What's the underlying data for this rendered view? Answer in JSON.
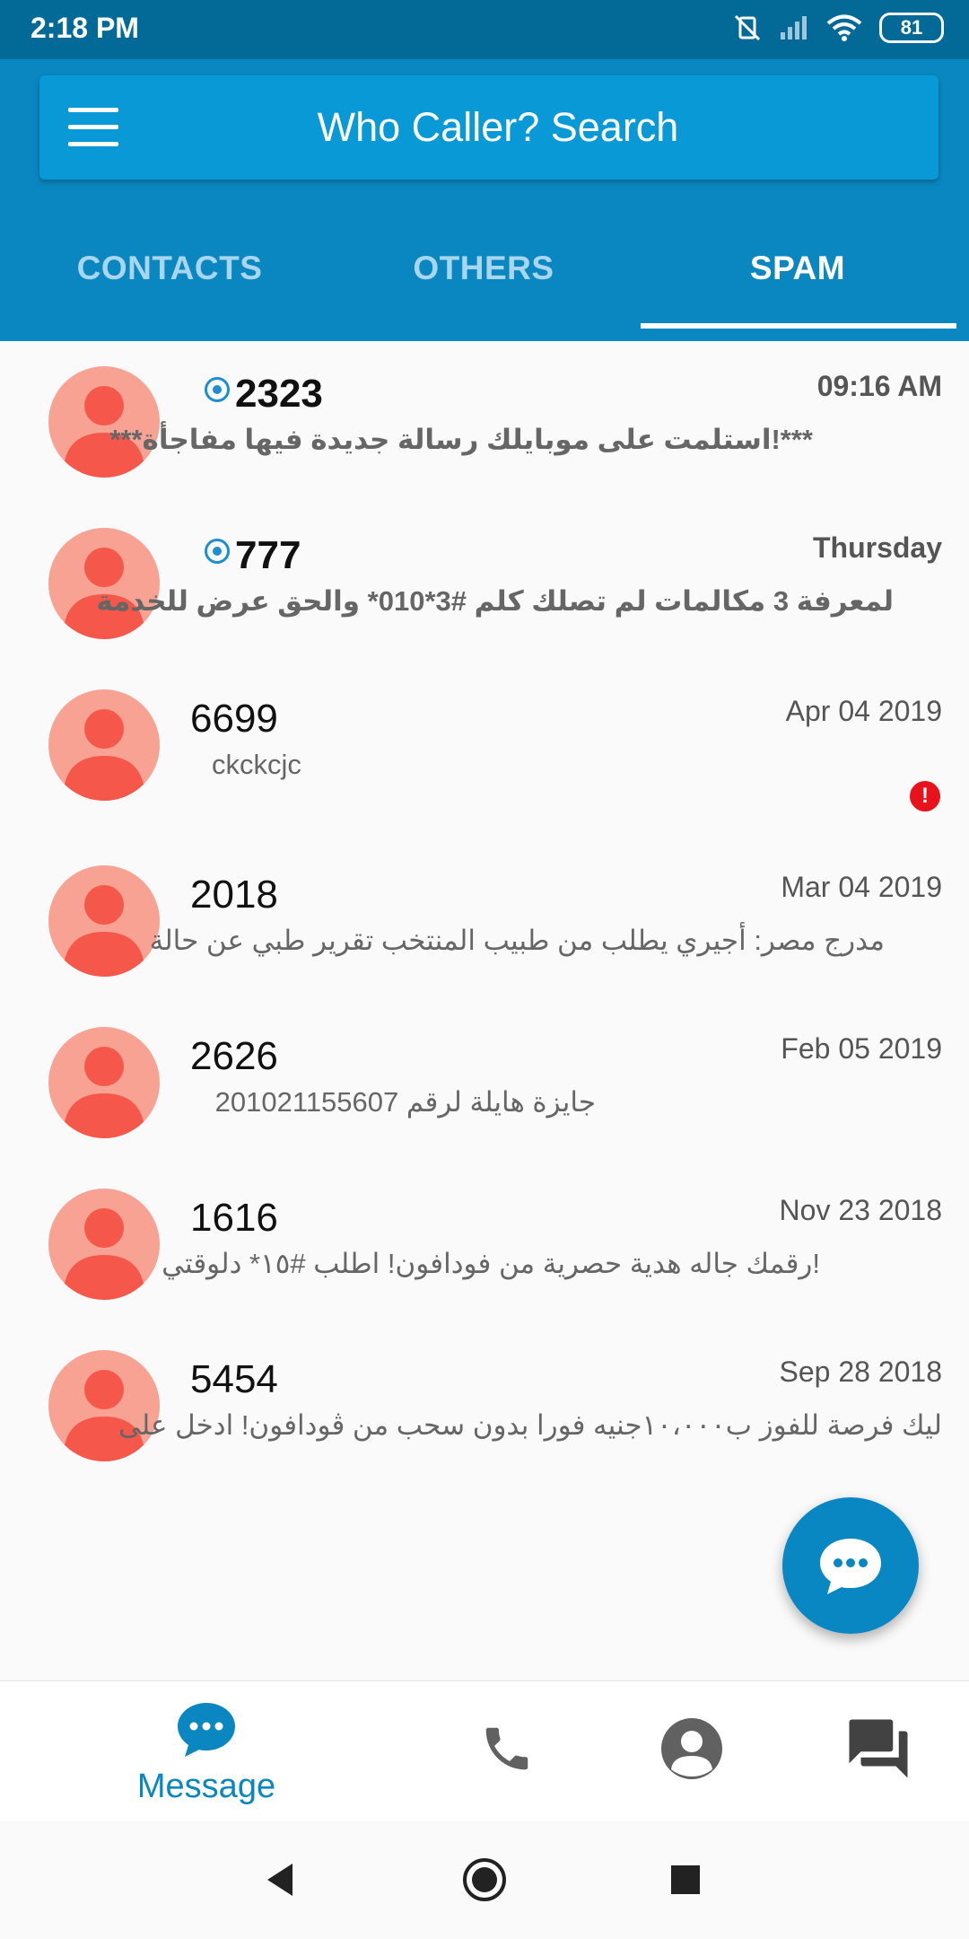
{
  "status_bar": {
    "time": "2:18 PM",
    "battery": "81"
  },
  "header": {
    "title": "Who Caller? Search"
  },
  "tabs": [
    {
      "label": "CONTACTS"
    },
    {
      "label": "OTHERS"
    },
    {
      "label": "SPAM"
    }
  ],
  "conversations": [
    {
      "number": "2323",
      "date": "09:16 AM",
      "snippet": "***!استلمت على موبايلك رسالة جديدة فيها مفاجأة***",
      "unread": true
    },
    {
      "number": "777",
      "date": "Thursday",
      "snippet": "لمعرفة 3 مكالمات لم تصلك كلم #3*010* والحق عرض للخدمة",
      "unread": true
    },
    {
      "number": "6699",
      "date": "Apr 04 2019",
      "snippet": "ckckcjc",
      "unread": false,
      "error": "!"
    },
    {
      "number": "2018",
      "date": "Mar 04 2019",
      "snippet": "مدرج مصر: أجيري يطلب من طبيب المنتخب تقرير طبي عن حالة",
      "unread": false
    },
    {
      "number": "2626",
      "date": "Feb 05 2019",
      "snippet": "جايزة هايلة لرقم 201021155607",
      "unread": false
    },
    {
      "number": "1616",
      "date": "Nov 23 2018",
      "snippet": "!رقمك جاله هدية حصرية من فودافون! اطلب #١٥* دلوقتي",
      "unread": false
    },
    {
      "number": "5454",
      "date": "Sep 28 2018",
      "snippet": "ليك فرصة للفوز ب١٠،٠٠٠جنيه فورا بدون سحب من ڤودافون! ادخل على",
      "unread": false
    }
  ],
  "bottom_nav": {
    "message_label": "Message"
  },
  "colors": {
    "primary": "#0a87c0",
    "status_bar": "#036a98",
    "avatar": "#f8a293",
    "avatar_figure": "#f5584a",
    "error": "#e8121c"
  }
}
